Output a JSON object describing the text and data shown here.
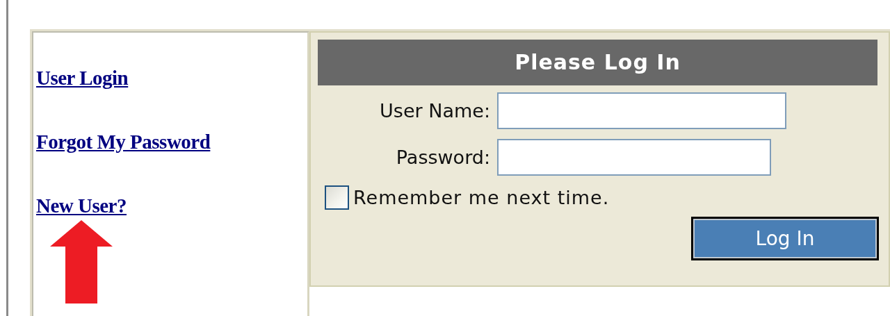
{
  "sidebar": {
    "links": [
      "User Login",
      "Forgot My Password",
      "New User?"
    ]
  },
  "login": {
    "title": "Please Log In",
    "fields": [
      {
        "label": "User Name:",
        "kind": "text"
      },
      {
        "label": "Password:",
        "kind": "password"
      }
    ],
    "remember": {
      "label": "Remember me next time.",
      "checked": false
    },
    "button": "Log In"
  }
}
